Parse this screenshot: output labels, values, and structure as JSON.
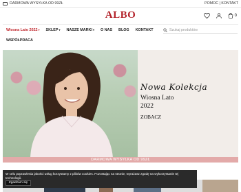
{
  "topbar": {
    "shipping_text": "DARMOWA WYSYŁKA OD 99ZŁ",
    "help_text": "POMOC | KONTAKT"
  },
  "brand": {
    "logo_text": "ALBO",
    "color": "#b3222a"
  },
  "header_icons": [
    "heart-icon",
    "user-icon",
    "cart-icon"
  ],
  "cart": {
    "count": "0"
  },
  "nav": {
    "items": [
      {
        "label": "Wiosna Lato 2022",
        "has_dropdown": true,
        "active": true
      },
      {
        "label": "SKLEP",
        "has_dropdown": true
      },
      {
        "label": "NASZE MARKI",
        "has_dropdown": true
      },
      {
        "label": "O NAS"
      },
      {
        "label": "BLOG"
      },
      {
        "label": "KONTAKT"
      }
    ],
    "second_row": "WSPÓŁPRACA"
  },
  "search": {
    "placeholder": "Szukaj produktów"
  },
  "hero": {
    "script_title": "Nowa Kolekcja",
    "season": "Wiosna Lato",
    "year": "2022",
    "cta": "ZOBACZ"
  },
  "banner": {
    "text": "DARMOWA WYSYŁKA OD 99ZŁ"
  },
  "cookie": {
    "text": "W celu poprawienia jakości usług korzystamy z plików cookies. Pozostając na stronie, wyrażasz zgodę na wykorzystanie tej technologii.",
    "accept_label": "Zgadzam się"
  }
}
